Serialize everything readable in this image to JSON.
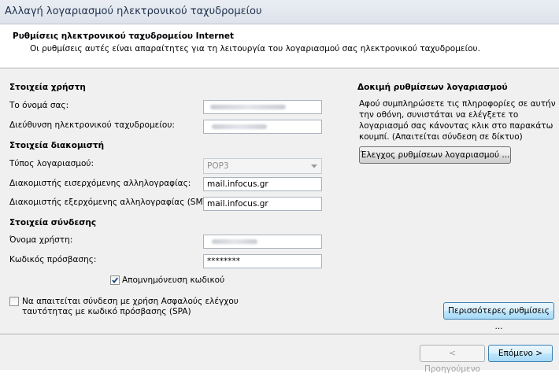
{
  "window": {
    "title": "Αλλαγή λογαριασμού ηλεκτρονικού ταχυδρομείου"
  },
  "header": {
    "title": "Ρυθμίσεις ηλεκτρονικού ταχυδρομείου Internet",
    "subtitle": "Οι ρυθμίσεις αυτές είναι απαραίτητες για τη λειτουργία του λογαριασμού σας ηλεκτρονικού ταχυδρομείου."
  },
  "user_info": {
    "section": "Στοιχεία χρήστη",
    "name_label": "Το όνομά σας:",
    "email_label": "Διεύθυνση ηλεκτρονικού ταχυδρομείου:"
  },
  "server_info": {
    "section": "Στοιχεία διακομιστή",
    "account_type_label": "Τύπος λογαριασμού:",
    "account_type_value": "POP3",
    "incoming_label": "Διακομιστής εισερχόμενης αλληλογραφίας:",
    "incoming_value": "mail.infocus.gr",
    "outgoing_label": "Διακομιστής εξερχόμενης αλληλογραφίας (SMTP):",
    "outgoing_value": "mail.infocus.gr"
  },
  "logon_info": {
    "section": "Στοιχεία σύνδεσης",
    "username_label": "Όνομα χρήστη:",
    "password_label": "Κωδικός πρόσβασης:",
    "password_value": "********",
    "remember_label": "Απομνημόνευση κωδικού",
    "remember_checked": true,
    "spa_label_line1": "Να απαιτείται σύνδεση με χρήση Ασφαλούς ελέγχου",
    "spa_label_line2": "ταυτότητας με κωδικό πρόσβασης (SPA)",
    "spa_checked": false
  },
  "test": {
    "section": "Δοκιμή ρυθμίσεων λογαριασμού",
    "description": "Αφού συμπληρώσετε τις πληροφορίες σε αυτήν την οθόνη, συνιστάται να ελέγξετε το λογαριασμό σας κάνοντας κλικ στο παρακάτω κουμπί. (Απαιτείται σύνδεση σε δίκτυο)",
    "test_button": "Έλεγχος ρυθμίσεων λογαριασμού ..."
  },
  "more_settings_button": "Περισσότερες ρυθμίσεις ...",
  "footer": {
    "back_button": "< Προηγούμενο",
    "next_button": "Επόμενο >"
  },
  "colors": {
    "accent": "#3c7fb1",
    "title_text": "#1f2f4a",
    "panel_bg": "#f0f0f0"
  },
  "icons": {
    "dropdown": "chevron-down-icon",
    "check": "check-icon"
  }
}
